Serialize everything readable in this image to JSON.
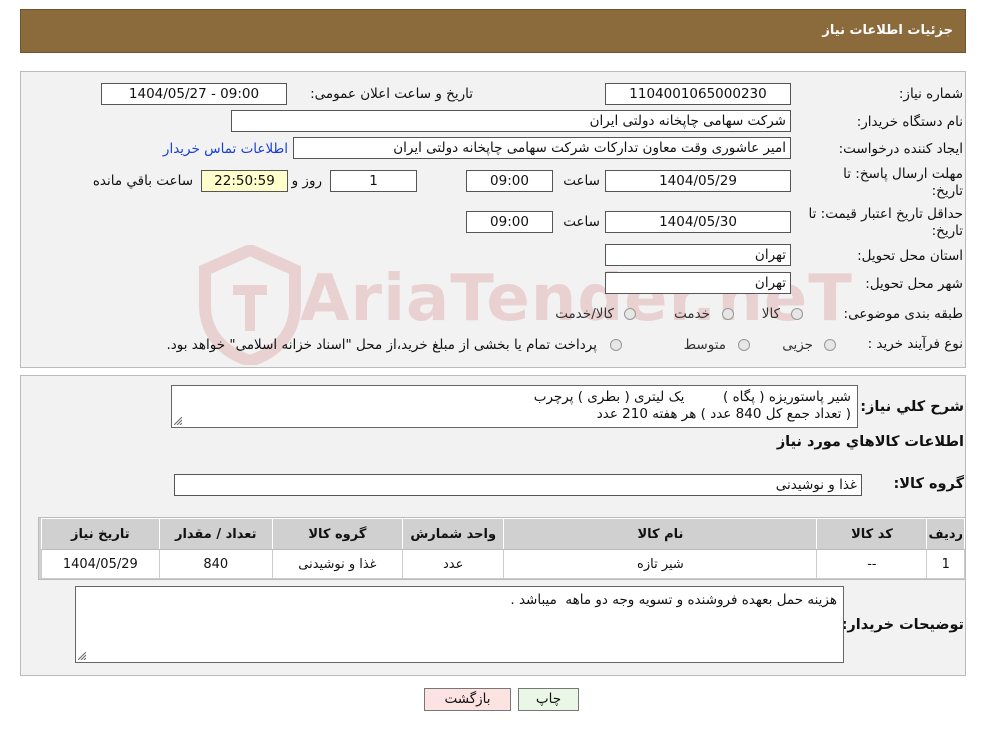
{
  "header": {
    "title": "جزئیات اطلاعات نیاز"
  },
  "form": {
    "need_number_label": "شماره نیاز:",
    "need_number": "1104001065000230",
    "announce_label": "تاریخ و ساعت اعلان عمومی:",
    "announce_value": "1404/05/27 - 09:00",
    "buyer_org_label": "نام دستگاه خریدار:",
    "buyer_org": "شرکت سهامی چاپخانه دولتی ایران",
    "creator_label": "ایجاد کننده درخواست:",
    "creator": "امیر عاشوری وقت معاون تدارکات شرکت سهامی چاپخانه دولتی ایران",
    "contact_link": "اطلاعات تماس خریدار",
    "reply_deadline_label_line1": "مهلت ارسال پاسخ: تا",
    "reply_deadline_label_line2": "تاریخ:",
    "reply_date": "1404/05/29",
    "time_label": "ساعت",
    "reply_time": "09:00",
    "days_value": "1",
    "days_label": "روز و",
    "remaining_time": "22:50:59",
    "remaining_label": "ساعت باقي مانده",
    "price_validity_label_line1": "حداقل تاریخ اعتبار قیمت: تا",
    "price_validity_label_line2": "تاریخ:",
    "price_validity_date": "1404/05/30",
    "price_validity_time": "09:00",
    "province_label": "استان محل تحویل:",
    "province": "تهران",
    "city_label": "شهر محل تحویل:",
    "city": "تهران",
    "category_label": "طبقه بندی موضوعی:",
    "category_options": [
      "کالا",
      "خدمت",
      "کالا/خدمت"
    ],
    "process_label": "نوع فرآیند خرید :",
    "process_options": [
      "جزیی",
      "متوسط"
    ],
    "process_note": "پرداخت تمام یا بخشی از مبلغ خرید،از محل \"اسناد خزانه اسلامی\" خواهد بود."
  },
  "description": {
    "label": "شرح کلي نياز:",
    "line1": "شیر پاستوریزه ( پگاه )         یک لیتری ( بطری ) پرچرب",
    "line2": "( تعداد جمع کل 840 عدد ) هر هفته 210 عدد"
  },
  "goods_info_title": "اطلاعات کالاهاي مورد نياز",
  "goods_group": {
    "label": "گروه کالا:",
    "value": "غذا و نوشیدنی"
  },
  "table": {
    "headers": [
      "ردیف",
      "کد کالا",
      "نام کالا",
      "واحد شمارش",
      "گروه کالا",
      "تعداد / مقدار",
      "تاریخ نیاز"
    ],
    "rows": [
      [
        "1",
        "--",
        "شیر تازه",
        "عدد",
        "غذا و نوشیدنی",
        "840",
        "1404/05/29"
      ]
    ]
  },
  "buyer_notes": {
    "label": "توضیحات خریدار:",
    "value": "هزینه حمل بعهده فروشنده و تسویه وجه دو ماهه  میباشد ."
  },
  "buttons": {
    "print": "چاپ",
    "back": "بازگشت"
  },
  "watermark": {
    "text": "AriaTender.neT"
  }
}
